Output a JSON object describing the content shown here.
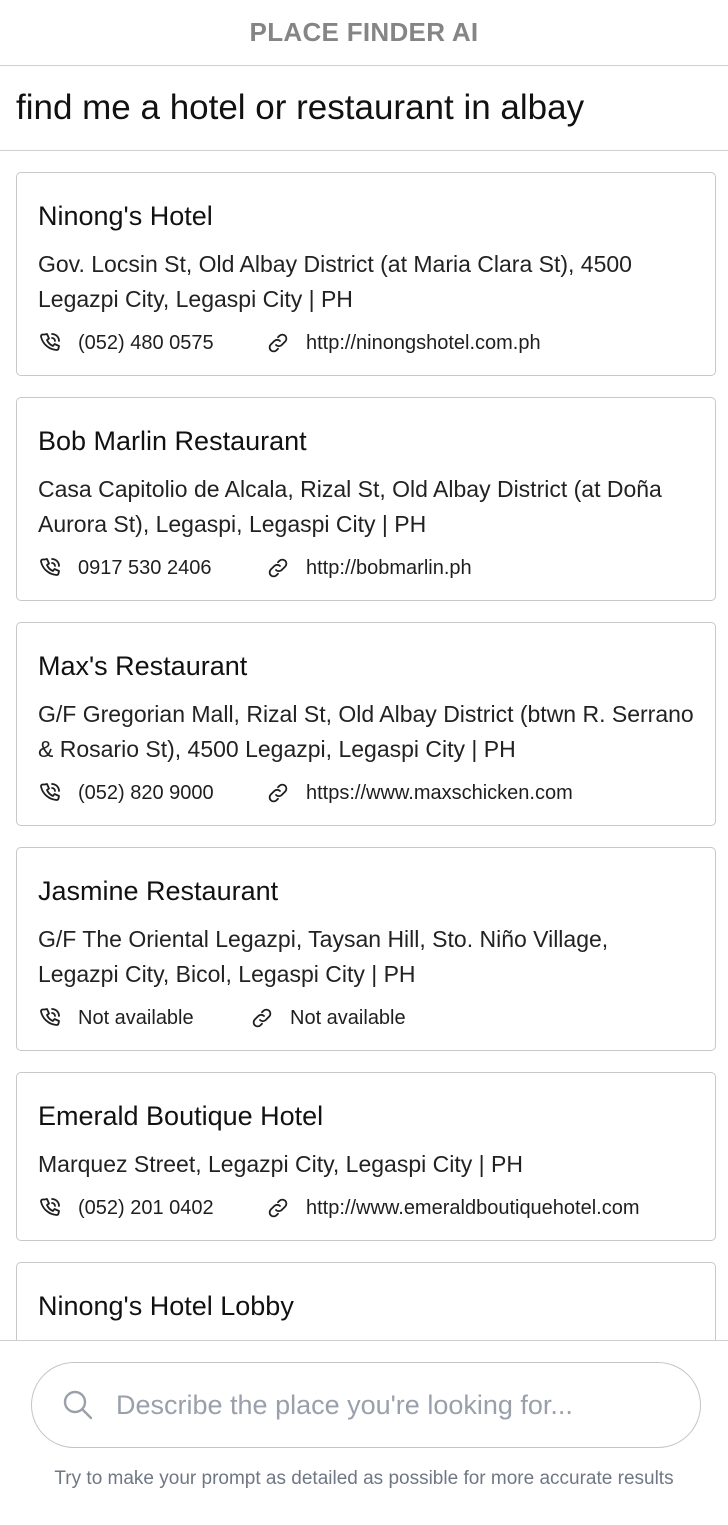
{
  "header": {
    "title": "PLACE FINDER AI"
  },
  "query": {
    "text": "find me a hotel or restaurant in albay"
  },
  "results": [
    {
      "name": "Ninong's Hotel",
      "address": "Gov. Locsin St, Old Albay District (at Maria Clara St), 4500 Legazpi City, Legaspi City | PH",
      "phone": "(052) 480 0575",
      "website": "http://ninongshotel.com.ph"
    },
    {
      "name": "Bob Marlin Restaurant",
      "address": "Casa Capitolio de Alcala, Rizal St, Old Albay District (at Doña Aurora St), Legaspi, Legaspi City | PH",
      "phone": "0917 530 2406",
      "website": "http://bobmarlin.ph"
    },
    {
      "name": "Max's Restaurant",
      "address": "G/F Gregorian Mall, Rizal St, Old Albay District (btwn R. Serrano & Rosario St), 4500 Legazpi, Legaspi City | PH",
      "phone": "(052) 820 9000",
      "website": "https://www.maxschicken.com"
    },
    {
      "name": "Jasmine Restaurant",
      "address": "G/F The Oriental Legazpi, Taysan Hill, Sto. Niño Village, Legazpi City, Bicol, Legaspi City | PH",
      "phone": "Not available",
      "website": "Not available"
    },
    {
      "name": "Emerald Boutique Hotel",
      "address": "Marquez Street, Legazpi City, Legaspi City | PH",
      "phone": "(052) 201 0402",
      "website": "http://www.emeraldboutiquehotel.com"
    },
    {
      "name": "Ninong's Hotel Lobby"
    }
  ],
  "search": {
    "placeholder": "Describe the place you're looking for...",
    "value": ""
  },
  "hint": "Try to make your prompt as detailed as possible for more accurate results",
  "icons": {
    "phone": "phone-call-icon",
    "website": "link-icon",
    "search": "search-icon"
  },
  "colors": {
    "title": "#858585",
    "border": "#c8c8c8",
    "placeholder": "#9aa0ab",
    "hint": "#6f7784"
  }
}
